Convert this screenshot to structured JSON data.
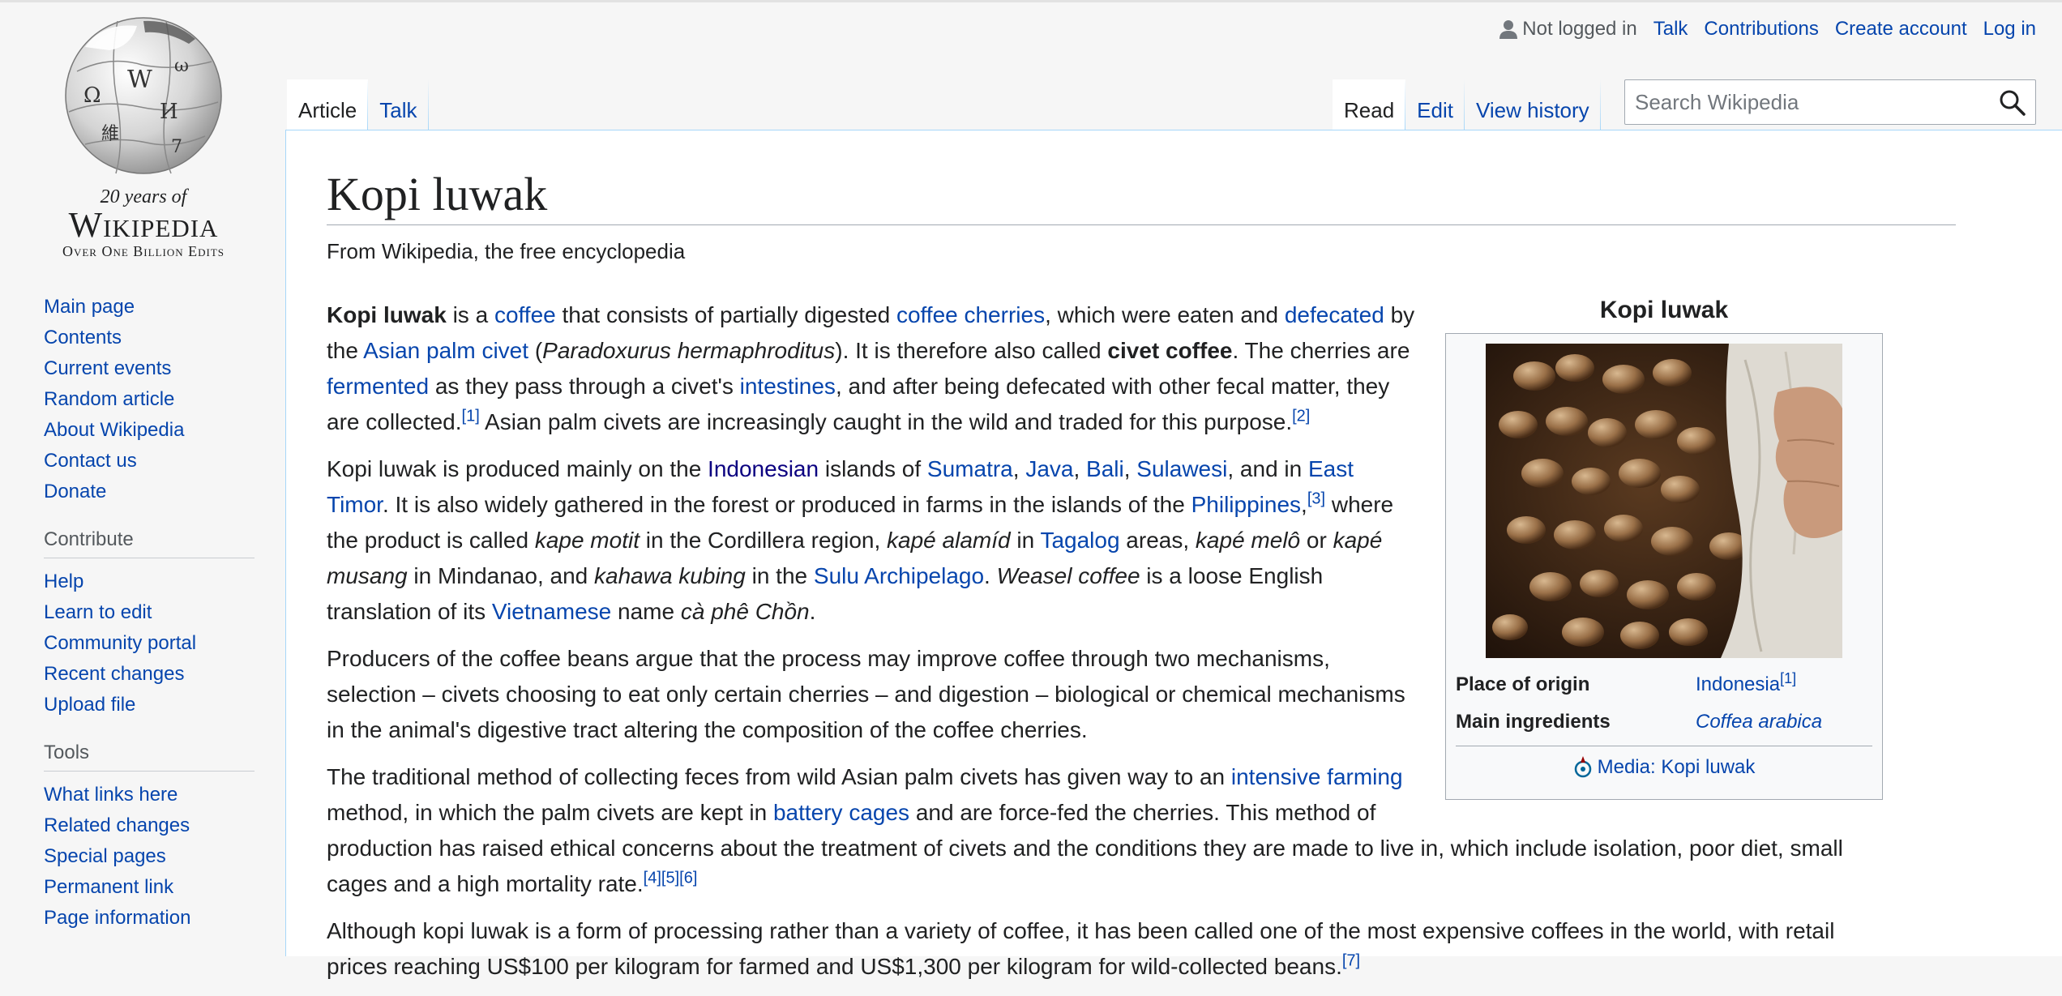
{
  "logo": {
    "wordmark": "Wikipedia",
    "tagline1": "20 years of",
    "tagline2": "Over One Billion Edits"
  },
  "sidebar": {
    "navigation": [
      "Main page",
      "Contents",
      "Current events",
      "Random article",
      "About Wikipedia",
      "Contact us",
      "Donate"
    ],
    "contribute_heading": "Contribute",
    "contribute": [
      "Help",
      "Learn to edit",
      "Community portal",
      "Recent changes",
      "Upload file"
    ],
    "tools_heading": "Tools",
    "tools": [
      "What links here",
      "Related changes",
      "Special pages",
      "Permanent link",
      "Page information"
    ]
  },
  "personal": {
    "not_logged_in": "Not logged in",
    "talk": "Talk",
    "contributions": "Contributions",
    "create_account": "Create account",
    "log_in": "Log in"
  },
  "tabs": {
    "article": "Article",
    "talk": "Talk",
    "read": "Read",
    "edit": "Edit",
    "view_history": "View history"
  },
  "search": {
    "placeholder": "Search Wikipedia"
  },
  "article": {
    "title": "Kopi luwak",
    "site_sub": "From Wikipedia, the free encyclopedia",
    "p1": {
      "b_kopi_luwak": "Kopi luwak",
      "t1": " is a ",
      "l_coffee": "coffee",
      "t2": " that consists of partially digested ",
      "l_coffee_cherries": "coffee cherries",
      "t3": ", which were eaten and ",
      "l_defecated": "defecated",
      "t4": " by the ",
      "l_asian_palm_civet": "Asian palm civet",
      "t5": " (",
      "i_species": "Paradoxurus hermaphroditus",
      "t6": "). It is therefore also called ",
      "b_civet_coffee": "civet coffee",
      "t7": ". The cherries are ",
      "l_fermented": "fermented",
      "t8": " as they pass through a civet's ",
      "l_intestines": "intestines",
      "t9": ", and after being defecated with other fecal matter, they are collected.",
      "ref1": "[1]",
      "t10": " Asian palm civets are increasingly caught in the wild and traded for this purpose.",
      "ref2": "[2]"
    },
    "p2": {
      "t1": "Kopi luwak is produced mainly on the ",
      "l_indonesian": "Indonesian",
      "t2": " islands of ",
      "l_sumatra": "Sumatra",
      "c1": ", ",
      "l_java": "Java",
      "c2": ", ",
      "l_bali": "Bali",
      "c3": ", ",
      "l_sulawesi": "Sulawesi",
      "t3": ", and in ",
      "l_east_timor": "East Timor",
      "t4": ". It is also widely gathered in the forest or produced in farms in the islands of the ",
      "l_philippines": "Philippines",
      "c4": ",",
      "ref3": "[3]",
      "t5": " where the product is called ",
      "i_kape_motit": "kape motit",
      "t6": " in the Cordillera region, ",
      "i_kape_alamid": "kapé alamíd",
      "t7": " in ",
      "l_tagalog": "Tagalog",
      "t8": " areas, ",
      "i_kape_melo": "kapé melô",
      "t9": " or ",
      "i_kape_musang": "kapé musang",
      "t10": " in Mindanao, and ",
      "i_kahawa_kubing": "kahawa kubing",
      "t11": " in the ",
      "l_sulu": "Sulu Archipelago",
      "t12": ". ",
      "i_weasel_coffee": "Weasel coffee",
      "t13": " is a loose English translation of its ",
      "l_vietnamese": "Vietnamese",
      "t14": " name ",
      "i_ca_phe_chon": "cà phê Chồn",
      "t15": "."
    },
    "p3": "Producers of the coffee beans argue that the process may improve coffee through two mechanisms, selection – civets choosing to eat only certain cherries – and digestion – biological or chemical mechanisms in the animal's digestive tract altering the composition of the coffee cherries.",
    "p4": {
      "t1": "The traditional method of collecting feces from wild Asian palm civets has given way to an ",
      "l_intensive_farming": "intensive farming",
      "t2": " method, in which the palm civets are kept in ",
      "l_battery_cages": "battery cages",
      "t3": " and are force-fed the cherries. This method of production has raised ethical concerns about the treatment of civets and the conditions they are made to live in, which include isolation, poor diet, small cages and a high mortality rate.",
      "ref4": "[4]",
      "ref5": "[5]",
      "ref6": "[6]"
    },
    "p5": {
      "t1": "Although kopi luwak is a form of processing rather than a variety of coffee, it has been called one of the most expensive coffees in the world, with retail prices reaching US$100 per kilogram for farmed and US$1,300 per kilogram for wild-collected beans.",
      "ref7": "[7]"
    }
  },
  "infobox": {
    "caption": "Kopi luwak",
    "origin_label": "Place of origin",
    "origin_value": "Indonesia",
    "origin_ref": "[1]",
    "ingredients_label": "Main ingredients",
    "ingredients_value": "Coffea arabica",
    "media_link": "Media: Kopi luwak"
  },
  "colors": {
    "link": "#0645ad",
    "visited": "#0b0080",
    "text": "#202122",
    "border": "#a2a9b1",
    "tab_border": "#a7d7f9"
  }
}
